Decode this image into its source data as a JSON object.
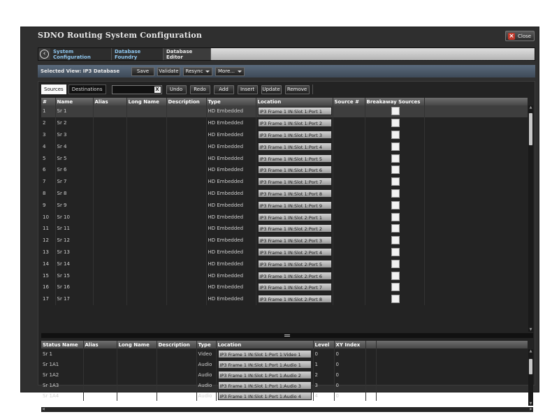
{
  "window": {
    "title": "SDNO Routing System Configuration",
    "close_label": "Close"
  },
  "breadcrumb": [
    "System Configuration",
    "Database Foundry",
    "Database Editor"
  ],
  "view": {
    "label": "Selected View:  IP3 Database",
    "buttons": [
      "Save",
      "Validate",
      "Resync",
      "More..."
    ]
  },
  "tabs": [
    "Sources",
    "Destinations"
  ],
  "search": {
    "value": ""
  },
  "actions": [
    "Undo",
    "Redo",
    "Add",
    "Insert",
    "Update",
    "Remove"
  ],
  "sources": {
    "columns": [
      "#",
      "Name",
      "Alias",
      "Long Name",
      "Description",
      "Type",
      "Location",
      "Source #",
      "Breakaway Sources",
      ""
    ],
    "rows": [
      {
        "num": "1",
        "name": "Sr 1",
        "type": "HD Embedded",
        "location": "IP3 Frame 1    IN:Slot 1:Port 1"
      },
      {
        "num": "2",
        "name": "Sr 2",
        "type": "HD Embedded",
        "location": "IP3 Frame 1    IN:Slot 1:Port 2"
      },
      {
        "num": "3",
        "name": "Sr 3",
        "type": "HD Embedded",
        "location": "IP3 Frame 1    IN:Slot 1:Port 3"
      },
      {
        "num": "4",
        "name": "Sr 4",
        "type": "HD Embedded",
        "location": "IP3 Frame 1    IN:Slot 1:Port 4"
      },
      {
        "num": "5",
        "name": "Sr 5",
        "type": "HD Embedded",
        "location": "IP3 Frame 1    IN:Slot 1:Port 5"
      },
      {
        "num": "6",
        "name": "Sr 6",
        "type": "HD Embedded",
        "location": "IP3 Frame 1    IN:Slot 1:Port 6"
      },
      {
        "num": "7",
        "name": "Sr 7",
        "type": "HD Embedded",
        "location": "IP3 Frame 1    IN:Slot 1:Port 7"
      },
      {
        "num": "8",
        "name": "Sr 8",
        "type": "HD Embedded",
        "location": "IP3 Frame 1    IN:Slot 1:Port 8"
      },
      {
        "num": "9",
        "name": "Sr 9",
        "type": "HD Embedded",
        "location": "IP3 Frame 1    IN:Slot 1:Port 9"
      },
      {
        "num": "10",
        "name": "Sr 10",
        "type": "HD Embedded",
        "location": "IP3 Frame 1    IN:Slot 2:Port 1"
      },
      {
        "num": "11",
        "name": "Sr 11",
        "type": "HD Embedded",
        "location": "IP3 Frame 1    IN:Slot 2:Port 2"
      },
      {
        "num": "12",
        "name": "Sr 12",
        "type": "HD Embedded",
        "location": "IP3 Frame 1    IN:Slot 2:Port 3"
      },
      {
        "num": "13",
        "name": "Sr 13",
        "type": "HD Embedded",
        "location": "IP3 Frame 1    IN:Slot 2:Port 4"
      },
      {
        "num": "14",
        "name": "Sr 14",
        "type": "HD Embedded",
        "location": "IP3 Frame 1    IN:Slot 2:Port 5"
      },
      {
        "num": "15",
        "name": "Sr 15",
        "type": "HD Embedded",
        "location": "IP3 Frame 1    IN:Slot 2:Port 6"
      },
      {
        "num": "16",
        "name": "Sr 16",
        "type": "HD Embedded",
        "location": "IP3 Frame 1    IN:Slot 2:Port 7"
      },
      {
        "num": "17",
        "name": "Sr 17",
        "type": "HD Embedded",
        "location": "IP3 Frame 1    IN:Slot 2:Port 8"
      }
    ]
  },
  "details": {
    "columns": [
      "Status Name",
      "Alias",
      "Long Name",
      "Description",
      "Type",
      "Location",
      "Level",
      "XY Index",
      "",
      ""
    ],
    "rows": [
      {
        "name": "Sr 1",
        "type": "Video",
        "location": "IP3 Frame 1    IN:Slot 1:Port 1:Video 1",
        "level": "0",
        "xy": "0"
      },
      {
        "name": "Sr 1A1",
        "type": "Audio",
        "location": "IP3 Frame 1    IN:Slot 1:Port 1:Audio 1",
        "level": "1",
        "xy": "0"
      },
      {
        "name": "Sr 1A2",
        "type": "Audio",
        "location": "IP3 Frame 1    IN:Slot 1:Port 1:Audio 2",
        "level": "2",
        "xy": "0"
      },
      {
        "name": "Sr 1A3",
        "type": "Audio",
        "location": "IP3 Frame 1    IN:Slot 1:Port 1:Audio 3",
        "level": "3",
        "xy": "0"
      },
      {
        "name": "Sr 1A4",
        "type": "Audio",
        "location": "IP3 Frame 1    IN:Slot 1:Port 1:Audio 4",
        "level": "4",
        "xy": "0"
      }
    ]
  }
}
